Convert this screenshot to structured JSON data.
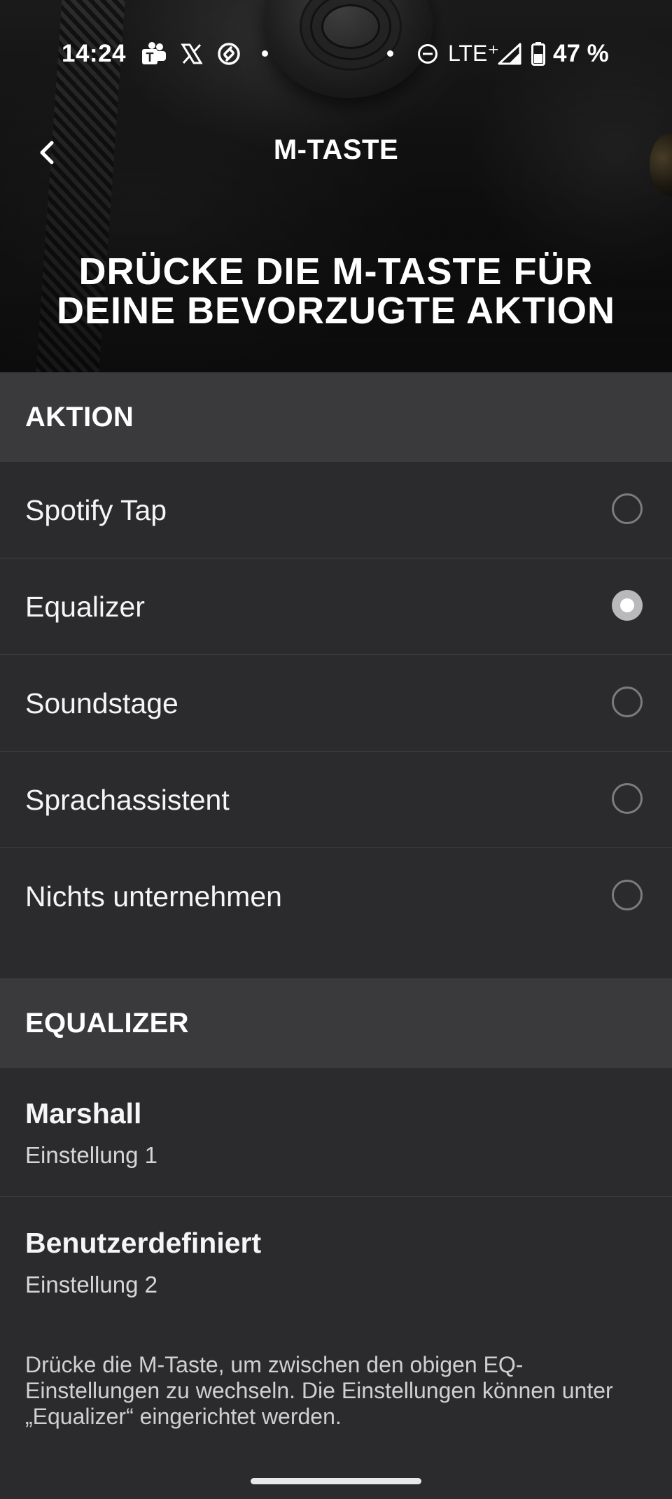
{
  "status_bar": {
    "time": "14:24",
    "network": "LTE⁺",
    "battery_percent": "47 %",
    "icons": [
      "teams-icon",
      "x-icon",
      "shazam-icon",
      "dnd-icon",
      "signal-icon",
      "battery-icon"
    ]
  },
  "nav": {
    "title": "M-TASTE"
  },
  "hero": {
    "headline_line1": "DRÜCKE DIE M-TASTE FÜR",
    "headline_line2": "DEINE BEVORZUGTE AKTION"
  },
  "action_section": {
    "header": "AKTION",
    "options": [
      {
        "label": "Spotify Tap",
        "selected": false
      },
      {
        "label": "Equalizer",
        "selected": true
      },
      {
        "label": "Soundstage",
        "selected": false
      },
      {
        "label": "Sprachassistent",
        "selected": false
      },
      {
        "label": "Nichts unternehmen",
        "selected": false
      }
    ]
  },
  "equalizer_section": {
    "header": "EQUALIZER",
    "items": [
      {
        "title": "Marshall",
        "subtitle": "Einstellung 1"
      },
      {
        "title": "Benutzerdefiniert",
        "subtitle": "Einstellung 2"
      }
    ],
    "note": "Drücke die M-Taste, um zwischen den obigen EQ-Einstellungen zu wechseln. Die Einstellungen können unter „Equalizer“ eingerichtet werden."
  },
  "colors": {
    "background": "#2b2b2d",
    "section_header_bg": "#3a3a3c",
    "radio_selected": "#b9b9bc",
    "radio_border": "#7c7c7f"
  }
}
